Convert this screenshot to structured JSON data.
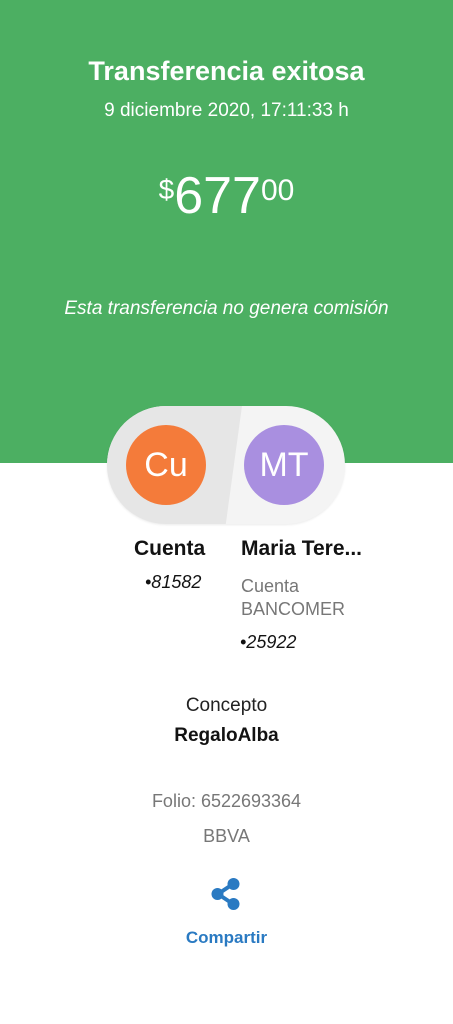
{
  "header": {
    "title": "Transferencia exitosa",
    "datetime": "9 diciembre 2020, 17:11:33 h",
    "amount": {
      "currency": "$",
      "integer": "677",
      "decimals": "00"
    },
    "note": "Esta transferencia no genera comisión"
  },
  "colors": {
    "header_bg": "#4caf62",
    "avatar_from": "#f47b3a",
    "avatar_to": "#a98fe0",
    "link": "#2a7ac2"
  },
  "from": {
    "initials": "Cu",
    "name": "Cuenta",
    "account": "•81582"
  },
  "to": {
    "initials": "MT",
    "name": "Maria Tere...",
    "bank_line1": "Cuenta",
    "bank_line2": "BANCOMER",
    "account": "•25922"
  },
  "concept": {
    "label": "Concepto",
    "value": "RegaloAlba"
  },
  "folio": "Folio: 6522693364",
  "bank": "BBVA",
  "actions": {
    "share_icon": "share-icon",
    "share_label": "Compartir"
  }
}
